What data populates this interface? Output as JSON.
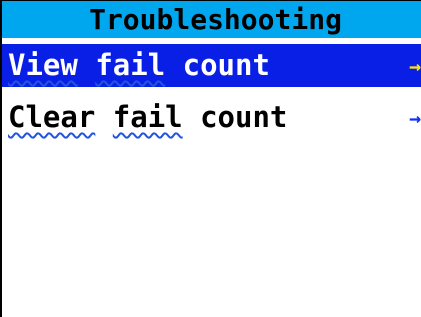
{
  "header": {
    "title": "Troubleshooting"
  },
  "menu": {
    "items": [
      {
        "word1": "View",
        "word2": "fail",
        "word3": "count",
        "arrow": "→",
        "selected": true
      },
      {
        "word1": "Clear",
        "word2": "fail",
        "word3": "count",
        "arrow": "→",
        "selected": false
      }
    ]
  },
  "colors": {
    "title_bar": "#00a6ee",
    "selected_row": "#0a1fe6",
    "selected_arrow": "#ffe400",
    "arrow": "#1030f0",
    "spellcheck_underline": "#2255dd"
  },
  "icons": {
    "menu_arrow": "right-arrow-icon"
  }
}
